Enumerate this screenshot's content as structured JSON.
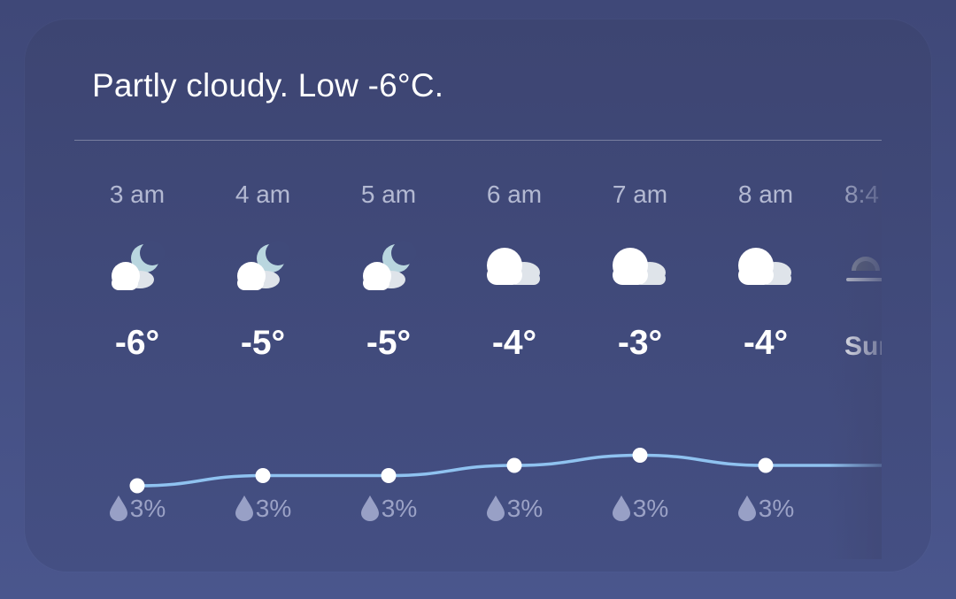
{
  "summary": "Partly cloudy. Low -6°C.",
  "colors": {
    "curve": "#8fc2f0",
    "point": "#ffffff",
    "card_top": "#3d4572",
    "card_bottom": "#444f83"
  },
  "temperature_unit": "°C",
  "hourly": [
    {
      "time": "3 am",
      "icon": "partly-cloudy-night-icon",
      "temp": "-6°",
      "temp_value": -6,
      "precip": "3%"
    },
    {
      "time": "4 am",
      "icon": "partly-cloudy-night-icon",
      "temp": "-5°",
      "temp_value": -5,
      "precip": "3%"
    },
    {
      "time": "5 am",
      "icon": "partly-cloudy-night-icon",
      "temp": "-5°",
      "temp_value": -5,
      "precip": "3%"
    },
    {
      "time": "6 am",
      "icon": "cloudy-icon",
      "temp": "-4°",
      "temp_value": -4,
      "precip": "3%"
    },
    {
      "time": "7 am",
      "icon": "cloudy-icon",
      "temp": "-3°",
      "temp_value": -3,
      "precip": "3%"
    },
    {
      "time": "8 am",
      "icon": "cloudy-icon",
      "temp": "-4°",
      "temp_value": -4,
      "precip": "3%"
    }
  ],
  "sunrise": {
    "time": "8:4",
    "label": "Sur",
    "icon": "sunrise-icon"
  }
}
